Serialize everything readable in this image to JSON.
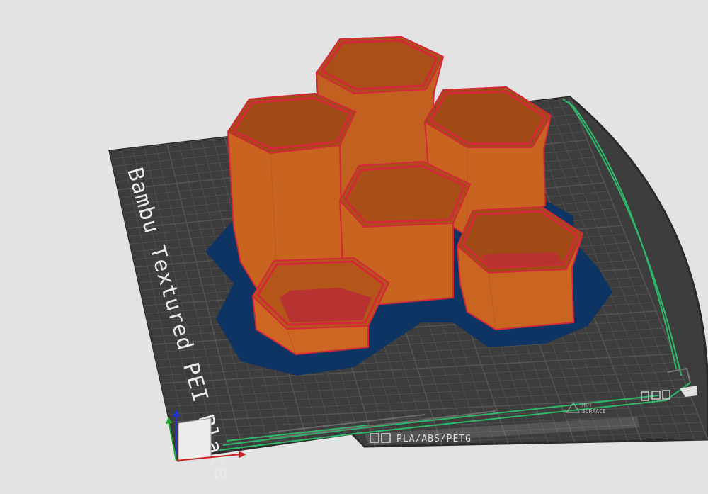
{
  "viewport": {
    "plate_label": "Bambu Textured PEI Plate",
    "material_label": "PLA/ABS/PETG",
    "surface_label_line1": "HOT",
    "surface_label_line2": "SURFACE"
  },
  "colors": {
    "background": "#e3e3e3",
    "plate": "#3d3d3d",
    "plate_edge": "#2a2a2a",
    "grid": "#555555",
    "model_orange": "#c7601f",
    "model_edge": "#d4283a",
    "brim_blue": "#0e3464",
    "bed_lines_green": "#2fb86a",
    "axis_x": "#cc2222",
    "axis_y": "#22aa33",
    "axis_z": "#2233cc"
  }
}
